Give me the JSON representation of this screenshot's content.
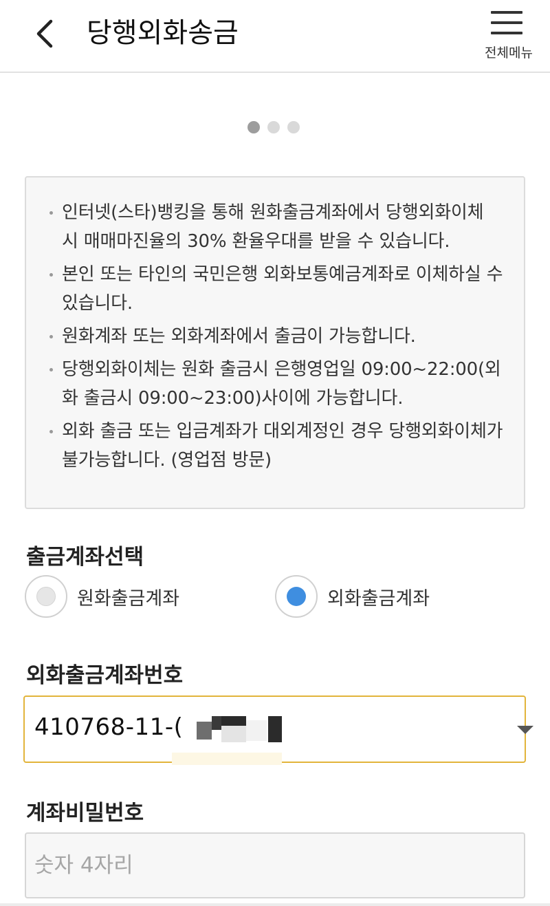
{
  "header": {
    "title": "당행외화송금",
    "back_icon": "chevron-left-icon",
    "menu_icon": "hamburger-icon",
    "menu_label": "전체메뉴"
  },
  "carousel": {
    "total": 3,
    "active_index": 0
  },
  "notice": {
    "items": [
      "인터넷(스타)뱅킹을 통해 원화출금계좌에서 당행외화이체 시 매매마진율의 30% 환율우대를 받을 수 있습니다.",
      "본인 또는 타인의 국민은행 외화보통예금계좌로 이체하실 수 있습니다.",
      "원화계좌 또는 외화계좌에서 출금이 가능합니다.",
      "당행외화이체는 원화 출금시 은행영업일 09:00~22:00(외화 출금시 09:00~23:00)사이에 가능합니다.",
      "외화 출금 또는 입금계좌가 대외계정인 경우 당행외화이체가 불가능합니다. (영업점 방문)"
    ]
  },
  "withdrawal_type": {
    "label": "출금계좌선택",
    "options": [
      {
        "label": "원화출금계좌",
        "selected": false
      },
      {
        "label": "외화출금계좌",
        "selected": true
      }
    ]
  },
  "account": {
    "label": "외화출금계좌번호",
    "value": "410768-11-(",
    "accent_color": "#e2b43a"
  },
  "password": {
    "label": "계좌비밀번호",
    "placeholder": "숫자 4자리"
  },
  "colors": {
    "radio_selected": "#3f8ee0",
    "notice_bg": "#f7f7f7"
  }
}
